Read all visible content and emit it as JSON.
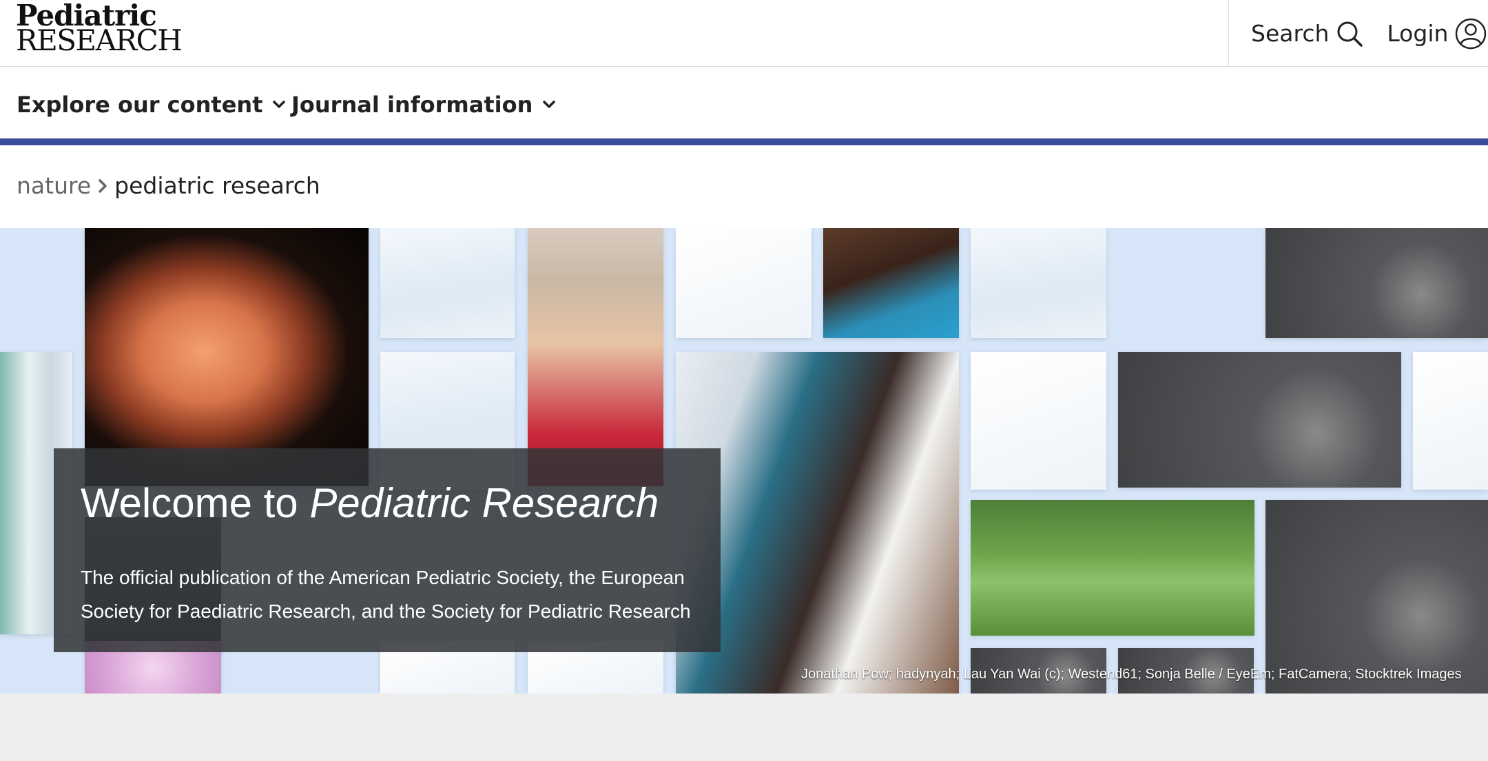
{
  "header": {
    "logo_line1": "Pediatric",
    "logo_line2": "RESEARCH",
    "search_label": "Search",
    "login_label": "Login"
  },
  "nav": {
    "items": [
      {
        "label": "Explore our content"
      },
      {
        "label": "Journal information"
      }
    ],
    "accent_color": "#3a4d9c"
  },
  "breadcrumb": {
    "home": "nature",
    "current": "pediatric research"
  },
  "hero": {
    "title_prefix": "Welcome to ",
    "title_emphasis": "Pediatric Research",
    "description": "The official publication of the American Pediatric Society, the European Society for Paediatric Research, and the Society for Pediatric Research",
    "image_credit": "Jonathan Pow; hadynyah; Lau Yan Wai (c); Westend61; Sonja Belle / EyeEm; FatCamera; Stocktrek Images"
  }
}
